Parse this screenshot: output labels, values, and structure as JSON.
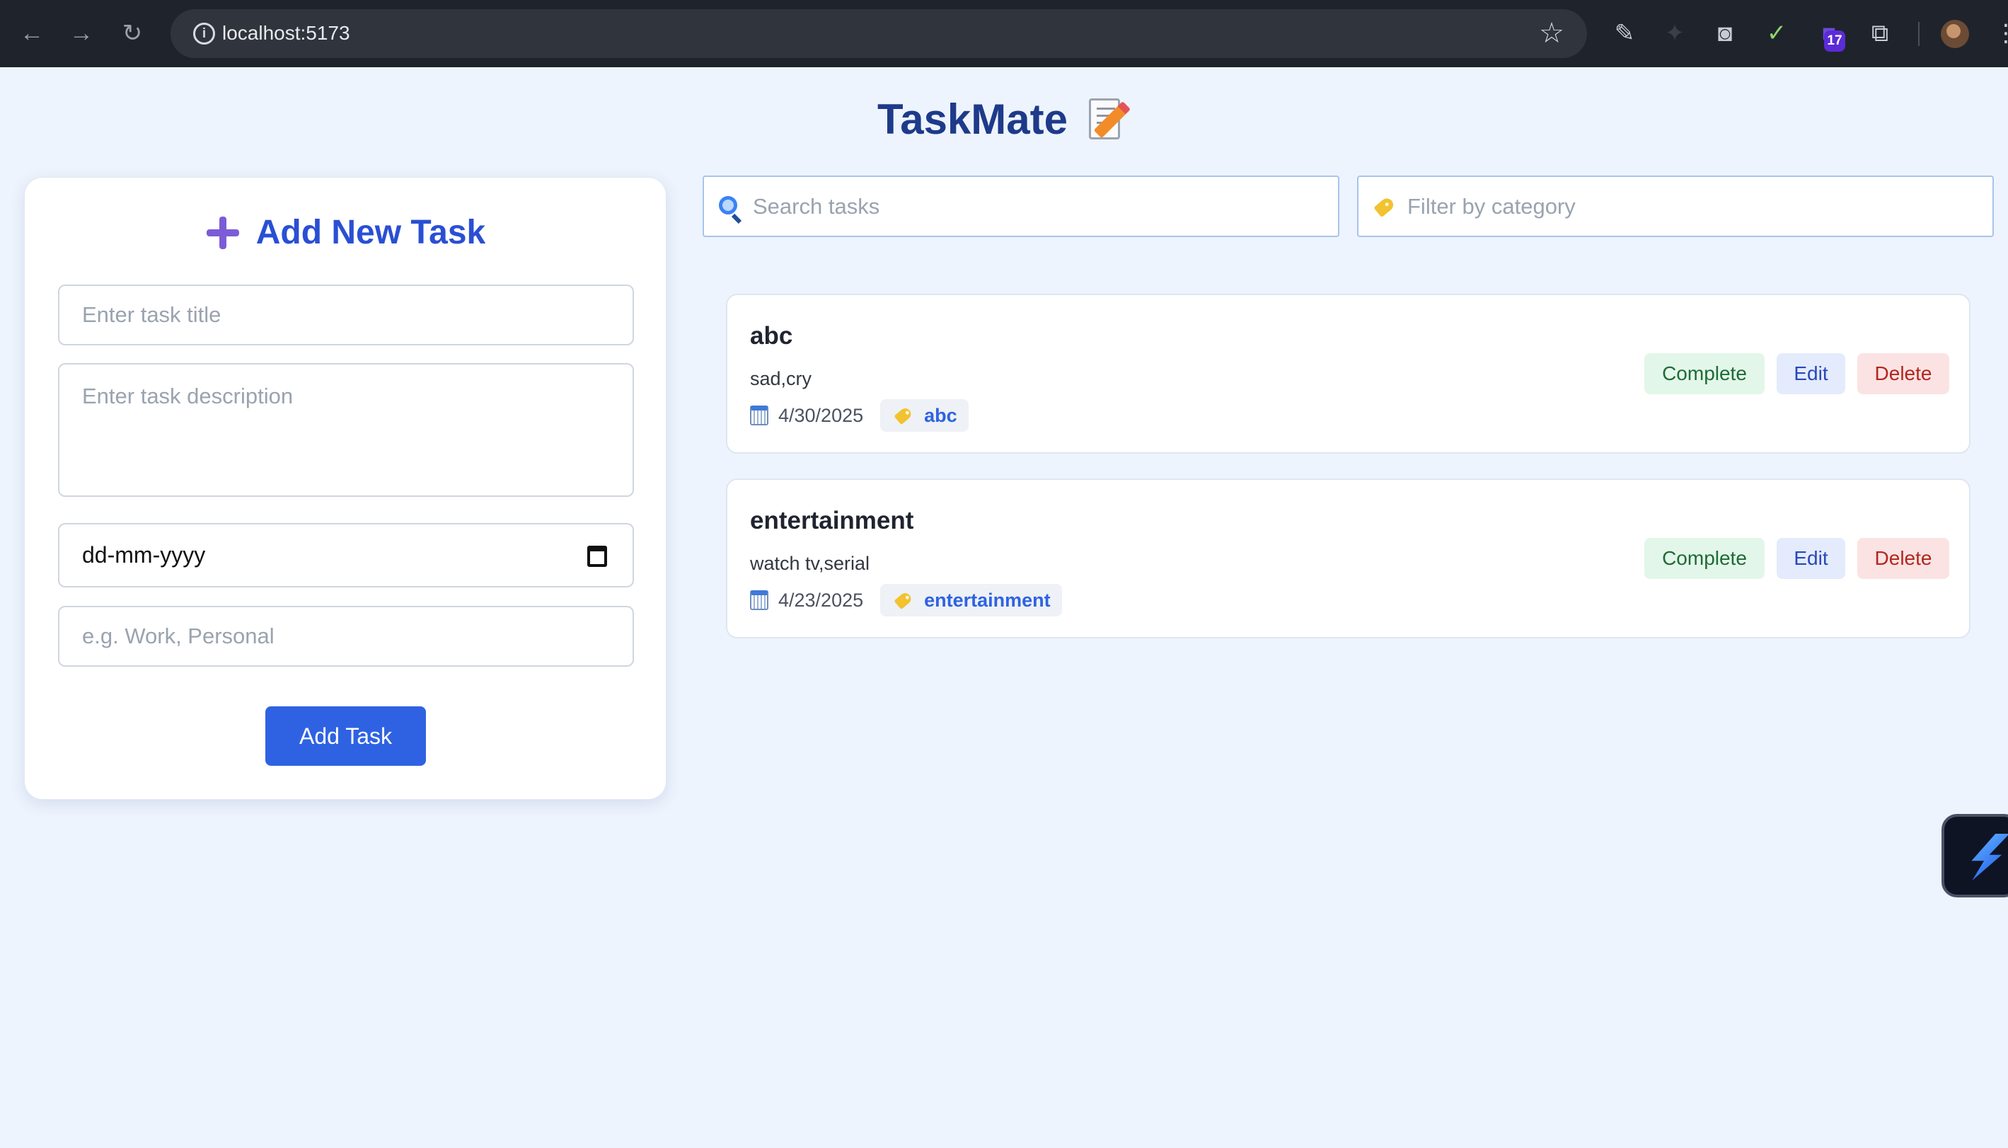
{
  "browser": {
    "url": "localhost:5173",
    "extension_badge": "17"
  },
  "app": {
    "title": "TaskMate"
  },
  "form": {
    "heading": "Add New Task",
    "title_placeholder": "Enter task title",
    "description_placeholder": "Enter task description",
    "date_placeholder": "dd-mm-yyyy",
    "category_placeholder": "e.g. Work, Personal",
    "submit_label": "Add Task"
  },
  "search": {
    "placeholder": "Search tasks"
  },
  "filter": {
    "placeholder": "Filter by category"
  },
  "tasks": [
    {
      "title": "abc",
      "description": "sad,cry",
      "date": "4/30/2025",
      "category": "abc"
    },
    {
      "title": "entertainment",
      "description": "watch tv,serial",
      "date": "4/23/2025",
      "category": "entertainment"
    }
  ],
  "actions": {
    "complete": "Complete",
    "edit": "Edit",
    "delete": "Delete"
  },
  "colors": {
    "primary": "#2f62e3",
    "title": "#1e3a8a",
    "background": "#eef4fd"
  }
}
